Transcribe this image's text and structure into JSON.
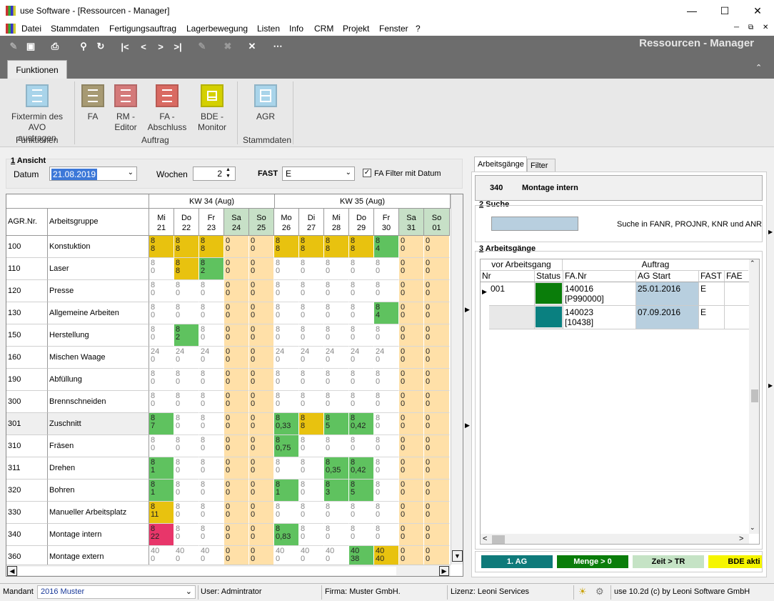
{
  "window": {
    "title": "use Software - [Ressourcen - Manager]"
  },
  "menu": [
    "Datei",
    "Stammdaten",
    "Fertigungsauftrag",
    "Lagerbewegung",
    "Listen",
    "Info",
    "CRM",
    "Projekt",
    "Fenster",
    "?"
  ],
  "app_title": "Ressourcen - Manager",
  "ribbon": {
    "tab": "Funktionen",
    "buttons": [
      {
        "label1": "Fixtermin des",
        "label2": "AVO austragen",
        "color": "#a9d4ea"
      },
      {
        "label1": "FA",
        "label2": "",
        "color": "#a79a73"
      },
      {
        "label1": "RM -",
        "label2": "Editor",
        "color": "#d47a7a"
      },
      {
        "label1": "FA -",
        "label2": "Abschluss",
        "color": "#d96a62"
      },
      {
        "label1": "BDE -",
        "label2": "Monitor",
        "color": "#d4d000"
      },
      {
        "label1": "AGR",
        "label2": "",
        "color": "#a9d4ea"
      }
    ],
    "groups": [
      "Funktionen",
      "Auftrag",
      "Stammdaten"
    ]
  },
  "ansicht": {
    "title_num": "1",
    "title": " Ansicht",
    "datum_label": "Datum",
    "datum_value": "21.08.2019",
    "wochen_label": "Wochen",
    "wochen_value": "2",
    "fast_label": "FAST",
    "fast_value": "E",
    "fa_filter_label": "FA Filter mit Datum"
  },
  "grid": {
    "col_agr": "AGR.Nr.",
    "col_group": "Arbeitsgruppe",
    "weeks": [
      "KW 34 (Aug)",
      "KW 35 (Aug)"
    ],
    "days": [
      {
        "d": "Mi",
        "n": "21"
      },
      {
        "d": "Do",
        "n": "22"
      },
      {
        "d": "Fr",
        "n": "23"
      },
      {
        "d": "Sa",
        "n": "24"
      },
      {
        "d": "So",
        "n": "25"
      },
      {
        "d": "Mo",
        "n": "26"
      },
      {
        "d": "Di",
        "n": "27"
      },
      {
        "d": "Mi",
        "n": "28"
      },
      {
        "d": "Do",
        "n": "29"
      },
      {
        "d": "Fr",
        "n": "30"
      },
      {
        "d": "Sa",
        "n": "31"
      },
      {
        "d": "So",
        "n": "01"
      }
    ],
    "rows": [
      {
        "nr": "100",
        "name": "Konstuktion",
        "cells": [
          [
            "8",
            "8",
            "y"
          ],
          [
            "8",
            "8",
            "y"
          ],
          [
            "8",
            "8",
            "y"
          ],
          [
            "0",
            "0",
            "w"
          ],
          [
            "0",
            "0",
            "w"
          ],
          [
            "8",
            "8",
            "y"
          ],
          [
            "8",
            "8",
            "y"
          ],
          [
            "8",
            "8",
            "y"
          ],
          [
            "8",
            "8",
            "y"
          ],
          [
            "8",
            "4",
            "g"
          ],
          [
            "0",
            "0",
            "w"
          ],
          [
            "0",
            "0",
            "w"
          ]
        ]
      },
      {
        "nr": "110",
        "name": "Laser",
        "cells": [
          [
            "8",
            "0",
            "e"
          ],
          [
            "8",
            "8",
            "y"
          ],
          [
            "8",
            "2",
            "g"
          ],
          [
            "0",
            "0",
            "w"
          ],
          [
            "0",
            "0",
            "w"
          ],
          [
            "8",
            "0",
            "e"
          ],
          [
            "8",
            "0",
            "e"
          ],
          [
            "8",
            "0",
            "e"
          ],
          [
            "8",
            "0",
            "e"
          ],
          [
            "8",
            "0",
            "e"
          ],
          [
            "0",
            "0",
            "w"
          ],
          [
            "0",
            "0",
            "w"
          ]
        ]
      },
      {
        "nr": "120",
        "name": "Presse",
        "cells": [
          [
            "8",
            "0",
            "e"
          ],
          [
            "8",
            "0",
            "e"
          ],
          [
            "8",
            "0",
            "e"
          ],
          [
            "0",
            "0",
            "w"
          ],
          [
            "0",
            "0",
            "w"
          ],
          [
            "8",
            "0",
            "e"
          ],
          [
            "8",
            "0",
            "e"
          ],
          [
            "8",
            "0",
            "e"
          ],
          [
            "8",
            "0",
            "e"
          ],
          [
            "8",
            "0",
            "e"
          ],
          [
            "0",
            "0",
            "w"
          ],
          [
            "0",
            "0",
            "w"
          ]
        ]
      },
      {
        "nr": "130",
        "name": "Allgemeine Arbeiten",
        "cells": [
          [
            "8",
            "0",
            "e"
          ],
          [
            "8",
            "0",
            "e"
          ],
          [
            "8",
            "0",
            "e"
          ],
          [
            "0",
            "0",
            "w"
          ],
          [
            "0",
            "0",
            "w"
          ],
          [
            "8",
            "0",
            "e"
          ],
          [
            "8",
            "0",
            "e"
          ],
          [
            "8",
            "0",
            "e"
          ],
          [
            "8",
            "0",
            "e"
          ],
          [
            "8",
            "4",
            "g"
          ],
          [
            "0",
            "0",
            "w"
          ],
          [
            "0",
            "0",
            "w"
          ]
        ]
      },
      {
        "nr": "150",
        "name": "Herstellung",
        "cells": [
          [
            "8",
            "0",
            "e"
          ],
          [
            "8",
            "2",
            "g"
          ],
          [
            "8",
            "0",
            "e"
          ],
          [
            "0",
            "0",
            "w"
          ],
          [
            "0",
            "0",
            "w"
          ],
          [
            "8",
            "0",
            "e"
          ],
          [
            "8",
            "0",
            "e"
          ],
          [
            "8",
            "0",
            "e"
          ],
          [
            "8",
            "0",
            "e"
          ],
          [
            "8",
            "0",
            "e"
          ],
          [
            "0",
            "0",
            "w"
          ],
          [
            "0",
            "0",
            "w"
          ]
        ]
      },
      {
        "nr": "160",
        "name": "Mischen Waage",
        "cells": [
          [
            "24",
            "0",
            "e"
          ],
          [
            "24",
            "0",
            "e"
          ],
          [
            "24",
            "0",
            "e"
          ],
          [
            "0",
            "0",
            "w"
          ],
          [
            "0",
            "0",
            "w"
          ],
          [
            "24",
            "0",
            "e"
          ],
          [
            "24",
            "0",
            "e"
          ],
          [
            "24",
            "0",
            "e"
          ],
          [
            "24",
            "0",
            "e"
          ],
          [
            "24",
            "0",
            "e"
          ],
          [
            "0",
            "0",
            "w"
          ],
          [
            "0",
            "0",
            "w"
          ]
        ]
      },
      {
        "nr": "190",
        "name": "Abfüllung",
        "cells": [
          [
            "8",
            "0",
            "e"
          ],
          [
            "8",
            "0",
            "e"
          ],
          [
            "8",
            "0",
            "e"
          ],
          [
            "0",
            "0",
            "w"
          ],
          [
            "0",
            "0",
            "w"
          ],
          [
            "8",
            "0",
            "e"
          ],
          [
            "8",
            "0",
            "e"
          ],
          [
            "8",
            "0",
            "e"
          ],
          [
            "8",
            "0",
            "e"
          ],
          [
            "8",
            "0",
            "e"
          ],
          [
            "0",
            "0",
            "w"
          ],
          [
            "0",
            "0",
            "w"
          ]
        ]
      },
      {
        "nr": "300",
        "name": "Brennschneiden",
        "cells": [
          [
            "8",
            "0",
            "e"
          ],
          [
            "8",
            "0",
            "e"
          ],
          [
            "8",
            "0",
            "e"
          ],
          [
            "0",
            "0",
            "w"
          ],
          [
            "0",
            "0",
            "w"
          ],
          [
            "8",
            "0",
            "e"
          ],
          [
            "8",
            "0",
            "e"
          ],
          [
            "8",
            "0",
            "e"
          ],
          [
            "8",
            "0",
            "e"
          ],
          [
            "8",
            "0",
            "e"
          ],
          [
            "0",
            "0",
            "w"
          ],
          [
            "0",
            "0",
            "w"
          ]
        ]
      },
      {
        "nr": "301",
        "name": "Zuschnitt",
        "cells": [
          [
            "8",
            "7",
            "g"
          ],
          [
            "8",
            "0",
            "e"
          ],
          [
            "8",
            "0",
            "e"
          ],
          [
            "0",
            "0",
            "w"
          ],
          [
            "0",
            "0",
            "w"
          ],
          [
            "8",
            "0,33",
            "g"
          ],
          [
            "8",
            "8",
            "y"
          ],
          [
            "8",
            "5",
            "g"
          ],
          [
            "8",
            "0,42",
            "g"
          ],
          [
            "8",
            "0",
            "e"
          ],
          [
            "0",
            "0",
            "w"
          ],
          [
            "0",
            "0",
            "w"
          ]
        ]
      },
      {
        "nr": "310",
        "name": "Fräsen",
        "cells": [
          [
            "8",
            "0",
            "e"
          ],
          [
            "8",
            "0",
            "e"
          ],
          [
            "8",
            "0",
            "e"
          ],
          [
            "0",
            "0",
            "w"
          ],
          [
            "0",
            "0",
            "w"
          ],
          [
            "8",
            "0,75",
            "g"
          ],
          [
            "8",
            "0",
            "e"
          ],
          [
            "8",
            "0",
            "e"
          ],
          [
            "8",
            "0",
            "e"
          ],
          [
            "8",
            "0",
            "e"
          ],
          [
            "0",
            "0",
            "w"
          ],
          [
            "0",
            "0",
            "w"
          ]
        ]
      },
      {
        "nr": "311",
        "name": "Drehen",
        "cells": [
          [
            "8",
            "1",
            "g"
          ],
          [
            "8",
            "0",
            "e"
          ],
          [
            "8",
            "0",
            "e"
          ],
          [
            "0",
            "0",
            "w"
          ],
          [
            "0",
            "0",
            "w"
          ],
          [
            "8",
            "0",
            "e"
          ],
          [
            "8",
            "0",
            "e"
          ],
          [
            "8",
            "0,35",
            "g"
          ],
          [
            "8",
            "0,42",
            "g"
          ],
          [
            "8",
            "0",
            "e"
          ],
          [
            "0",
            "0",
            "w"
          ],
          [
            "0",
            "0",
            "w"
          ]
        ]
      },
      {
        "nr": "320",
        "name": "Bohren",
        "cells": [
          [
            "8",
            "1",
            "g"
          ],
          [
            "8",
            "0",
            "e"
          ],
          [
            "8",
            "0",
            "e"
          ],
          [
            "0",
            "0",
            "w"
          ],
          [
            "0",
            "0",
            "w"
          ],
          [
            "8",
            "1",
            "g"
          ],
          [
            "8",
            "0",
            "e"
          ],
          [
            "8",
            "3",
            "g"
          ],
          [
            "8",
            "5",
            "g"
          ],
          [
            "8",
            "0",
            "e"
          ],
          [
            "0",
            "0",
            "w"
          ],
          [
            "0",
            "0",
            "w"
          ]
        ]
      },
      {
        "nr": "330",
        "name": "Manueller Arbeitsplatz",
        "cells": [
          [
            "8",
            "11",
            "y"
          ],
          [
            "8",
            "0",
            "e"
          ],
          [
            "8",
            "0",
            "e"
          ],
          [
            "0",
            "0",
            "w"
          ],
          [
            "0",
            "0",
            "w"
          ],
          [
            "8",
            "0",
            "e"
          ],
          [
            "8",
            "0",
            "e"
          ],
          [
            "8",
            "0",
            "e"
          ],
          [
            "8",
            "0",
            "e"
          ],
          [
            "8",
            "0",
            "e"
          ],
          [
            "0",
            "0",
            "w"
          ],
          [
            "0",
            "0",
            "w"
          ]
        ]
      },
      {
        "nr": "340",
        "name": "Montage intern",
        "cells": [
          [
            "8",
            "22",
            "r"
          ],
          [
            "8",
            "0",
            "e"
          ],
          [
            "8",
            "0",
            "e"
          ],
          [
            "0",
            "0",
            "w"
          ],
          [
            "0",
            "0",
            "w"
          ],
          [
            "8",
            "0,83",
            "g"
          ],
          [
            "8",
            "0",
            "e"
          ],
          [
            "8",
            "0",
            "e"
          ],
          [
            "8",
            "0",
            "e"
          ],
          [
            "8",
            "0",
            "e"
          ],
          [
            "0",
            "0",
            "w"
          ],
          [
            "0",
            "0",
            "w"
          ]
        ]
      },
      {
        "nr": "360",
        "name": "Montage extern",
        "cells": [
          [
            "40",
            "0",
            "e"
          ],
          [
            "40",
            "0",
            "e"
          ],
          [
            "40",
            "0",
            "e"
          ],
          [
            "0",
            "0",
            "w"
          ],
          [
            "0",
            "0",
            "w"
          ],
          [
            "40",
            "0",
            "e"
          ],
          [
            "40",
            "0",
            "e"
          ],
          [
            "40",
            "0",
            "e"
          ],
          [
            "40",
            "38",
            "g"
          ],
          [
            "40",
            "40",
            "y"
          ],
          [
            "0",
            "0",
            "w"
          ],
          [
            "0",
            "0",
            "w"
          ]
        ]
      }
    ]
  },
  "right": {
    "tabs": [
      "Arbeitsgänge",
      "Filter"
    ],
    "header_nr": "340",
    "header_name": "Montage intern",
    "suche_num": "2",
    "suche_title": " Suche",
    "suche_hint": "Suche in FANR, PROJNR, KNR und ANR",
    "ag_num": "3",
    "ag_title": " Arbeitsgänge",
    "col_vor": "vor Arbeitsgang",
    "col_auftrag": "Auftrag",
    "cols": [
      "Nr",
      "Status",
      "FA.Nr",
      "AG Start",
      "FAST",
      "FAE"
    ],
    "rows": [
      {
        "nr": "001",
        "status_color": "#0a7d0a",
        "fa1": "140016",
        "fa2": "[P990000]",
        "start": "25.01.2016",
        "fast": "E"
      },
      {
        "nr": "",
        "status_color": "#0a8080",
        "fa1": "140023",
        "fa2": "[10438]",
        "start": "07.09.2016",
        "fast": "E"
      }
    ],
    "legend": [
      {
        "label": "1. AG",
        "bg": "#0e7a7a",
        "fg": "#fff"
      },
      {
        "label": "Menge > 0",
        "bg": "#0a7d0a",
        "fg": "#fff"
      },
      {
        "label": "Zeit > TR",
        "bg": "#c5e3c5",
        "fg": "#000"
      },
      {
        "label": "BDE akti",
        "bg": "#f5f500",
        "fg": "#000"
      }
    ]
  },
  "status": {
    "mandant_label": "Mandant",
    "mandant_value": "2016 Muster",
    "user": "User: Admintrator",
    "firma": "Firma: Muster GmbH.",
    "lizenz": "Lizenz: Leoni Services",
    "version": "use 10.2d (c) by Leoni Software GmbH"
  }
}
